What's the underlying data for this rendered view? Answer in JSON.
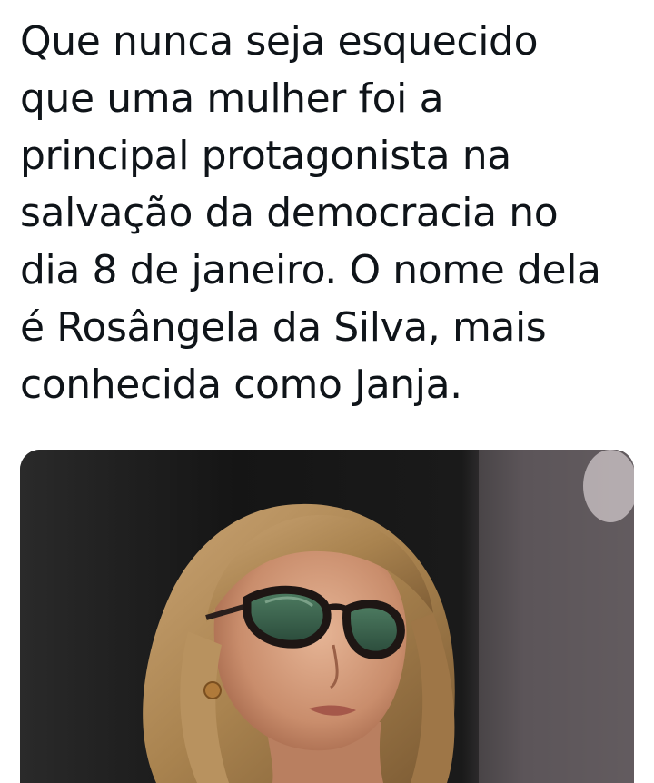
{
  "tweet": {
    "lines": [
      "Que nunca seja esquecido",
      "que uma mulher foi a",
      "principal protagonista na",
      "salvação da democracia no",
      "dia 8 de janeiro. O nome dela",
      "é Rosângela da Silva, mais",
      "conhecida como Janja."
    ]
  },
  "media": {
    "icon": "photo-woman-with-glasses"
  }
}
